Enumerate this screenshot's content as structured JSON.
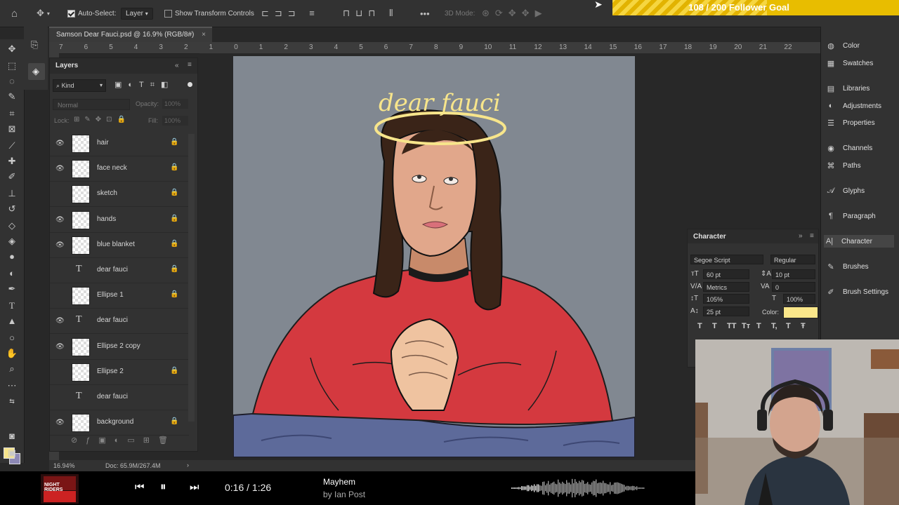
{
  "options_bar": {
    "auto_select_label": "Auto-Select:",
    "auto_select_value": "Layer",
    "show_transform_label": "Show Transform Controls",
    "more_label": "•••",
    "mode_3d_label": "3D Mode:"
  },
  "goal": {
    "text": "108 / 200 Follower Goal",
    "current": 108,
    "target": 200
  },
  "document": {
    "tab_title": "Samson Dear Fauci.psd @ 16.9% (RGB/8#)",
    "close_glyph": "×",
    "zoom": "16.94%",
    "doc_size": "Doc: 65.9M/267.4M"
  },
  "ruler": {
    "numbers": [
      "7",
      "6",
      "5",
      "4",
      "3",
      "2",
      "1",
      "0",
      "1",
      "2",
      "3",
      "4",
      "5",
      "6",
      "7",
      "8",
      "9",
      "10",
      "11",
      "12",
      "13",
      "14",
      "15",
      "16",
      "17",
      "18",
      "19",
      "20",
      "21",
      "22"
    ]
  },
  "layers_panel": {
    "title": "Layers",
    "filter_kind": "Kind",
    "blend_mode": "Normal",
    "opacity_label": "Opacity:",
    "opacity_value": "100%",
    "lock_label": "Lock:",
    "fill_label": "Fill:",
    "fill_value": "100%",
    "layers": [
      {
        "name": "hair",
        "visible": true,
        "type": "pixel",
        "locked": true
      },
      {
        "name": "face neck",
        "visible": true,
        "type": "pixel",
        "locked": true
      },
      {
        "name": "sketch",
        "visible": false,
        "type": "pixel",
        "locked": true
      },
      {
        "name": "hands",
        "visible": true,
        "type": "pixel",
        "locked": true
      },
      {
        "name": "blue blanket",
        "visible": true,
        "type": "pixel",
        "locked": true
      },
      {
        "name": "dear fauci",
        "visible": false,
        "type": "text",
        "locked": true
      },
      {
        "name": "Ellipse 1",
        "visible": false,
        "type": "shape",
        "locked": true
      },
      {
        "name": "dear fauci",
        "visible": true,
        "type": "text",
        "locked": false
      },
      {
        "name": "Ellipse 2 copy",
        "visible": true,
        "type": "shape",
        "locked": false
      },
      {
        "name": "Ellipse 2",
        "visible": false,
        "type": "shape",
        "locked": true
      },
      {
        "name": "dear fauci",
        "visible": false,
        "type": "text",
        "locked": false
      },
      {
        "name": "background",
        "visible": true,
        "type": "pixel",
        "locked": true
      }
    ]
  },
  "canvas": {
    "title_text": "dear fauci",
    "bg_color": "#818891",
    "halo_color": "#f7e58b",
    "sweater_color": "#d4393f",
    "blanket_color": "#5d6a9a"
  },
  "right_panel": {
    "items": [
      {
        "label": "Color",
        "icon": "color-icon"
      },
      {
        "label": "Swatches",
        "icon": "swatches-icon"
      },
      {
        "label": "Libraries",
        "icon": "libraries-icon"
      },
      {
        "label": "Adjustments",
        "icon": "adjustments-icon"
      },
      {
        "label": "Properties",
        "icon": "properties-icon"
      },
      {
        "label": "Channels",
        "icon": "channels-icon"
      },
      {
        "label": "Paths",
        "icon": "paths-icon"
      },
      {
        "label": "Glyphs",
        "icon": "glyphs-icon"
      },
      {
        "label": "Paragraph",
        "icon": "paragraph-icon"
      },
      {
        "label": "Character",
        "icon": "character-icon"
      },
      {
        "label": "Brushes",
        "icon": "brushes-icon"
      },
      {
        "label": "Brush Settings",
        "icon": "brush-settings-icon"
      }
    ]
  },
  "character_panel": {
    "title": "Character",
    "font_family": "Segoe Script",
    "font_style": "Regular",
    "font_size": "60 pt",
    "leading": "10 pt",
    "kerning": "Metrics",
    "tracking": "0",
    "vertical_scale": "105%",
    "horizontal_scale": "100%",
    "baseline_shift": "25 pt",
    "color_label": "Color:",
    "color_value": "#fbe78a",
    "style_buttons": [
      "T",
      "T",
      "TT",
      "Tт",
      "T",
      "T,",
      "T",
      "Ŧ"
    ]
  },
  "media_player": {
    "time": "0:16 / 1:26",
    "song": "Mayhem",
    "artist": "by Ian Post",
    "album_text": "NIGHT RIDERS"
  }
}
